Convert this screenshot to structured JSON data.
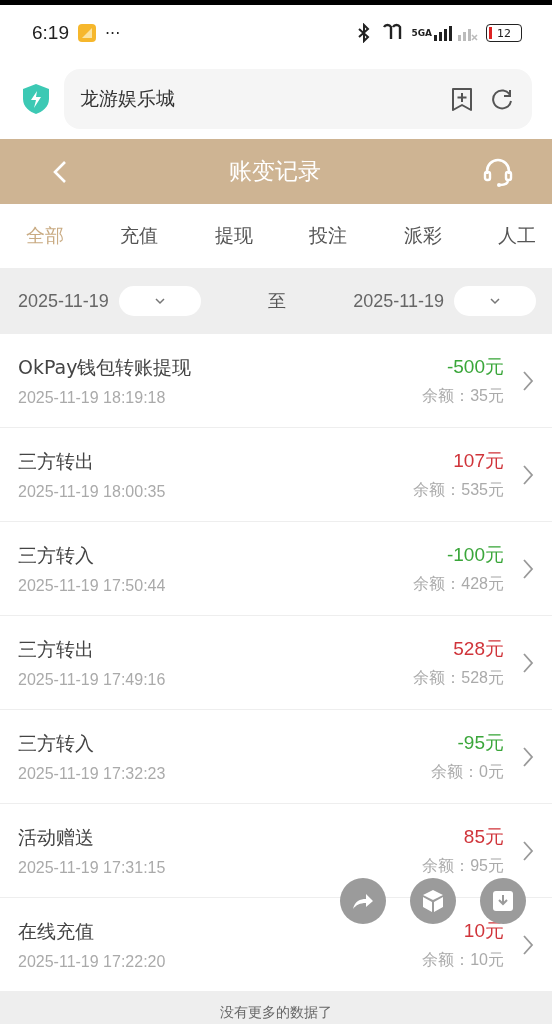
{
  "status_bar": {
    "time": "6:19",
    "more": "···",
    "network": "5GA",
    "battery": "12"
  },
  "browser": {
    "address": "龙游娱乐城"
  },
  "header": {
    "title": "账变记录"
  },
  "tabs": [
    {
      "label": "全部",
      "selected": true
    },
    {
      "label": "充值",
      "selected": false
    },
    {
      "label": "提现",
      "selected": false
    },
    {
      "label": "投注",
      "selected": false
    },
    {
      "label": "派彩",
      "selected": false
    },
    {
      "label": "人工",
      "selected": false
    }
  ],
  "date_filter": {
    "start": "2025-11-19",
    "separator": "至",
    "end": "2025-11-19"
  },
  "records": [
    {
      "title": "OkPay钱包转账提现",
      "time": "2025-11-19 18:19:18",
      "amount": "-500元",
      "color": "#3aa63a",
      "balance": "余额：35元"
    },
    {
      "title": "三方转出",
      "time": "2025-11-19 18:00:35",
      "amount": "107元",
      "color": "#d0343a",
      "balance": "余额：535元"
    },
    {
      "title": "三方转入",
      "time": "2025-11-19 17:50:44",
      "amount": "-100元",
      "color": "#3aa63a",
      "balance": "余额：428元"
    },
    {
      "title": "三方转出",
      "time": "2025-11-19 17:49:16",
      "amount": "528元",
      "color": "#d0343a",
      "balance": "余额：528元"
    },
    {
      "title": "三方转入",
      "time": "2025-11-19 17:32:23",
      "amount": "-95元",
      "color": "#3aa63a",
      "balance": "余额：0元"
    },
    {
      "title": "活动赠送",
      "time": "2025-11-19 17:31:15",
      "amount": "85元",
      "color": "#d0343a",
      "balance": "余额：95元"
    },
    {
      "title": "在线充值",
      "time": "2025-11-19 17:22:20",
      "amount": "10元",
      "color": "#d0343a",
      "balance": "余额：10元"
    }
  ],
  "footer": {
    "text": "没有更多的数据了"
  }
}
